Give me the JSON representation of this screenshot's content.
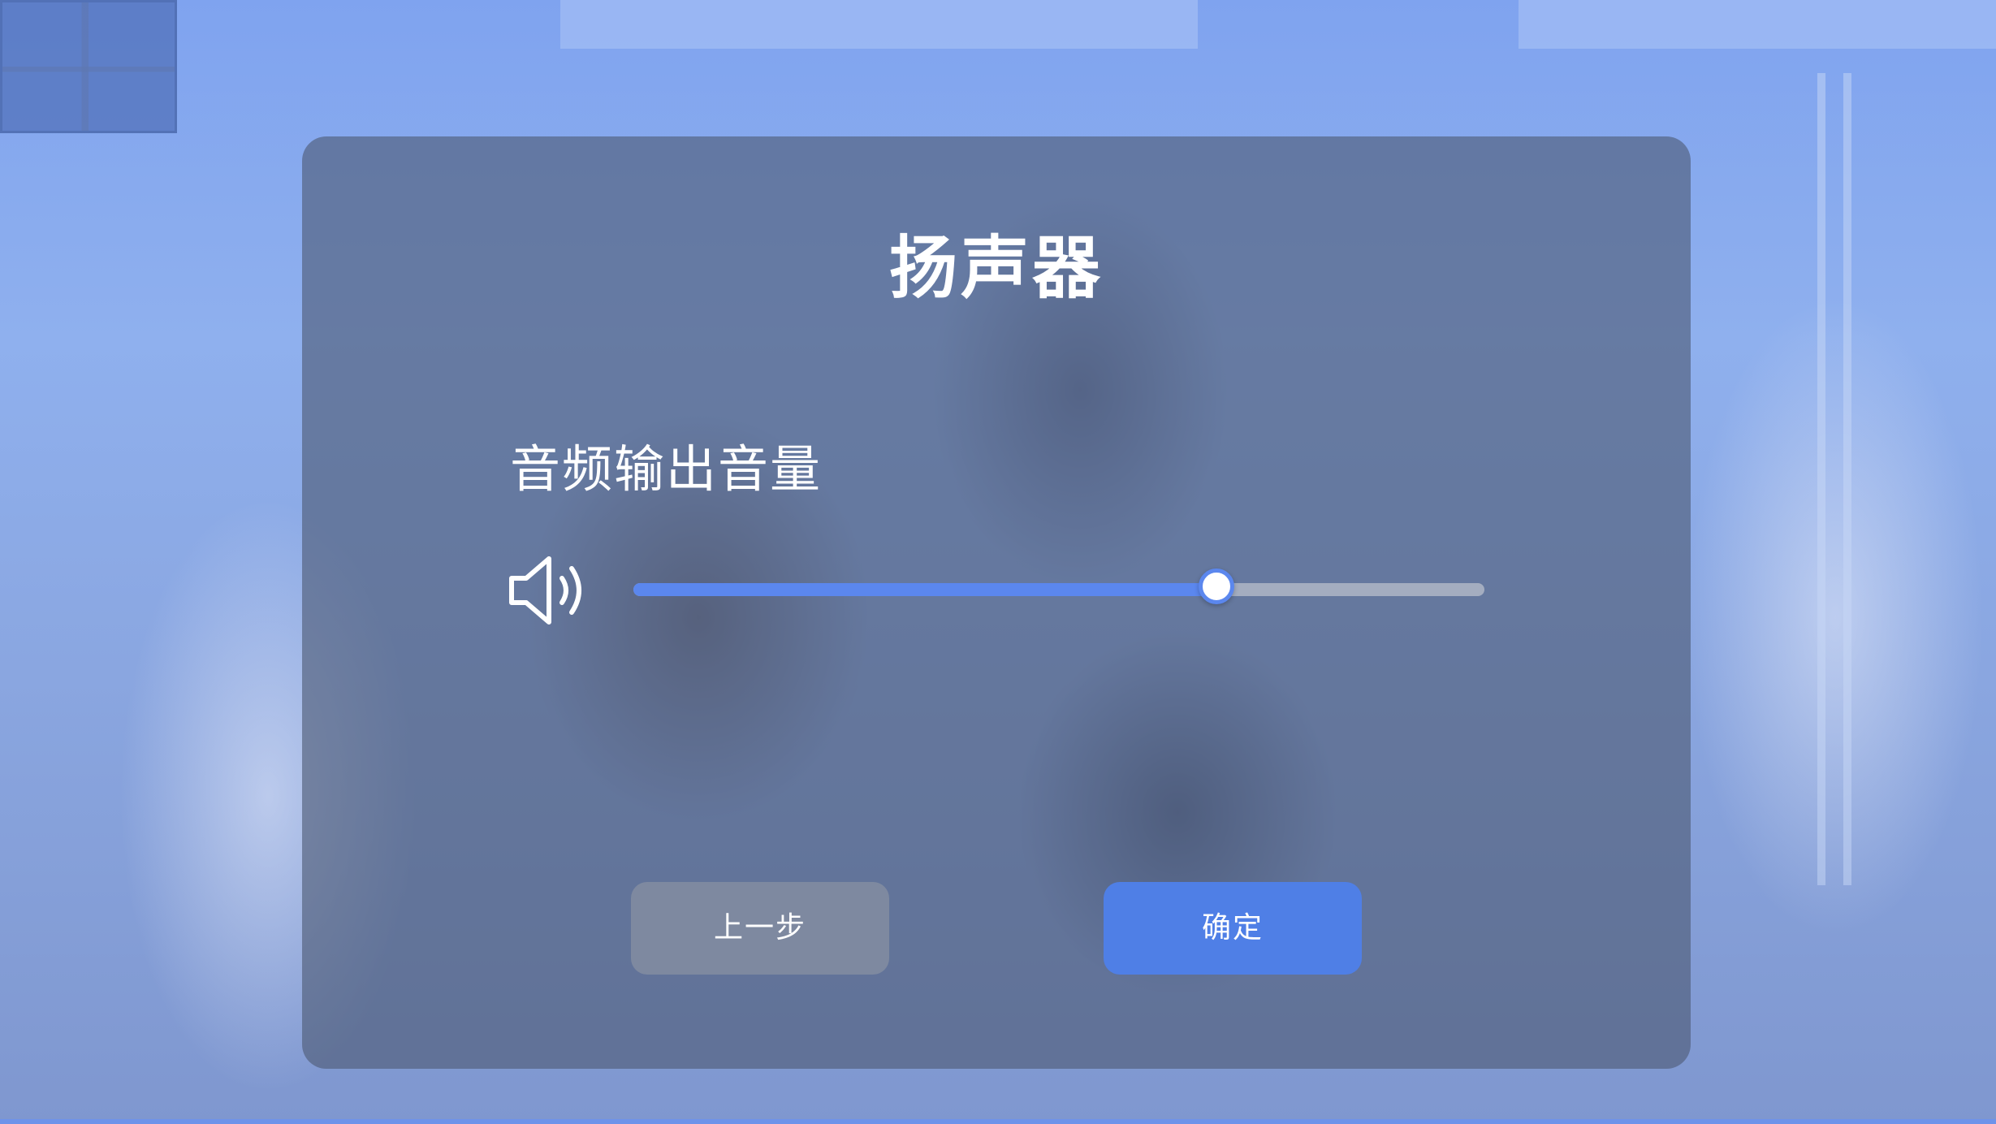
{
  "dialog": {
    "title": "扬声器",
    "volume_label": "音频输出音量",
    "speaker_icon": "speaker-volume-icon",
    "volume": {
      "value": 0.685,
      "min": 0,
      "max": 1
    },
    "prev_button_label": "上一步",
    "confirm_button_label": "确定"
  },
  "colors": {
    "accent": "#4f7fe6",
    "slider_fill": "#5b87ee",
    "dialog_bg": "rgba(78,90,116,0.62)",
    "text": "#ffffff"
  }
}
